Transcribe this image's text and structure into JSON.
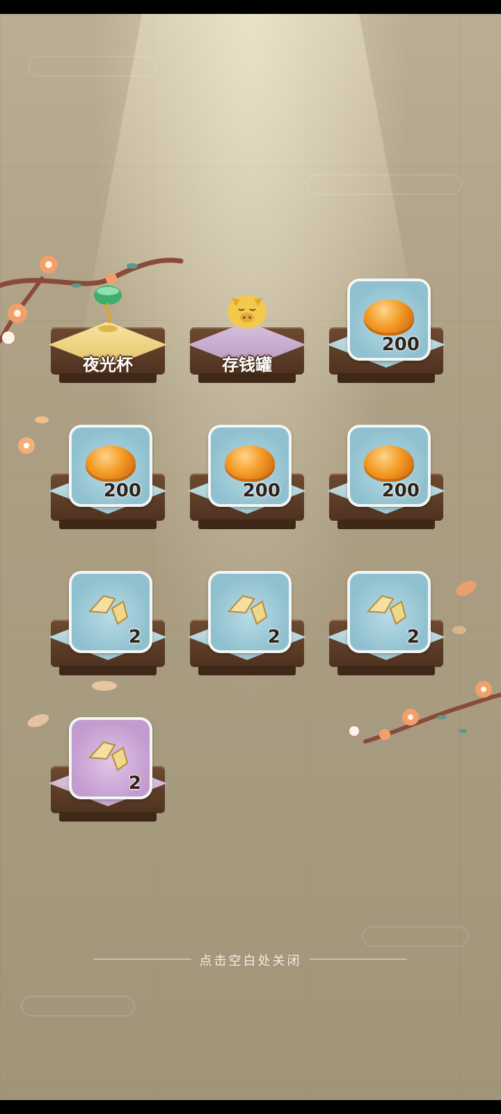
{
  "rewards": [
    {
      "kind": "item",
      "name": "夜光杯",
      "icon": "luminous-cup-icon",
      "cloth": "gold"
    },
    {
      "kind": "item",
      "name": "存钱罐",
      "icon": "piggy-bank-icon",
      "cloth": "purple"
    },
    {
      "kind": "card",
      "rarity": "blue",
      "icon": "amber-stone-icon",
      "count": "200"
    },
    {
      "kind": "card",
      "rarity": "blue",
      "icon": "amber-stone-icon",
      "count": "200"
    },
    {
      "kind": "card",
      "rarity": "blue",
      "icon": "amber-stone-icon",
      "count": "200"
    },
    {
      "kind": "card",
      "rarity": "blue",
      "icon": "amber-stone-icon",
      "count": "200"
    },
    {
      "kind": "card",
      "rarity": "blue",
      "icon": "gold-shard-icon",
      "count": "2"
    },
    {
      "kind": "card",
      "rarity": "blue",
      "icon": "gold-shard-icon",
      "count": "2"
    },
    {
      "kind": "card",
      "rarity": "blue",
      "icon": "gold-shard-icon",
      "count": "2"
    },
    {
      "kind": "card",
      "rarity": "purple",
      "icon": "gold-shard-icon",
      "count": "2"
    }
  ],
  "footer": {
    "close_hint": "点击空白处关闭"
  },
  "colors": {
    "blue_rarity": "#9ec6cf",
    "purple_rarity": "#c39ccf",
    "gold_rarity": "#e2c266",
    "table_wood": "#5a3a25"
  }
}
